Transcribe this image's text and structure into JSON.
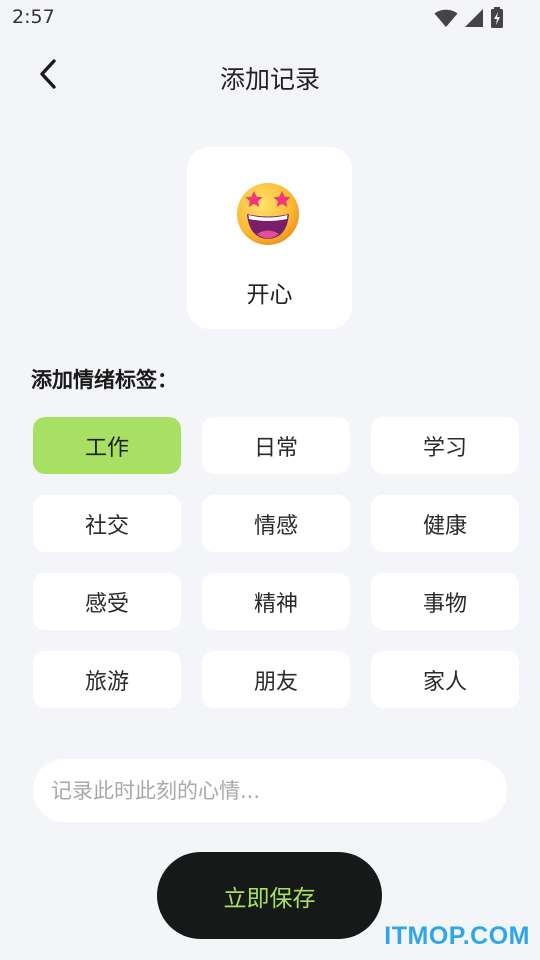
{
  "status_bar": {
    "time": "2:57",
    "icons": [
      "wifi-icon",
      "cell-signal-icon",
      "battery-charging-icon"
    ]
  },
  "header": {
    "back_icon": "chevron-left-icon",
    "title": "添加记录"
  },
  "mood": {
    "emoji_icon": "star-struck-emoji-icon",
    "label": "开心"
  },
  "tags_section": {
    "label": "添加情绪标签："
  },
  "tags": [
    {
      "label": "工作",
      "selected": true
    },
    {
      "label": "日常",
      "selected": false
    },
    {
      "label": "学习",
      "selected": false
    },
    {
      "label": "社交",
      "selected": false
    },
    {
      "label": "情感",
      "selected": false
    },
    {
      "label": "健康",
      "selected": false
    },
    {
      "label": "感受",
      "selected": false
    },
    {
      "label": "精神",
      "selected": false
    },
    {
      "label": "事物",
      "selected": false
    },
    {
      "label": "旅游",
      "selected": false
    },
    {
      "label": "朋友",
      "selected": false
    },
    {
      "label": "家人",
      "selected": false
    }
  ],
  "note": {
    "placeholder": "记录此时此刻的心情...",
    "value": ""
  },
  "save": {
    "label": "立即保存"
  },
  "watermark": {
    "text": "ITMOP.COM"
  },
  "colors": {
    "background": "#F4F5F9",
    "accent_green": "#A8E063",
    "save_button_bg": "#161918",
    "watermark_blue": "#2FA6E8"
  }
}
